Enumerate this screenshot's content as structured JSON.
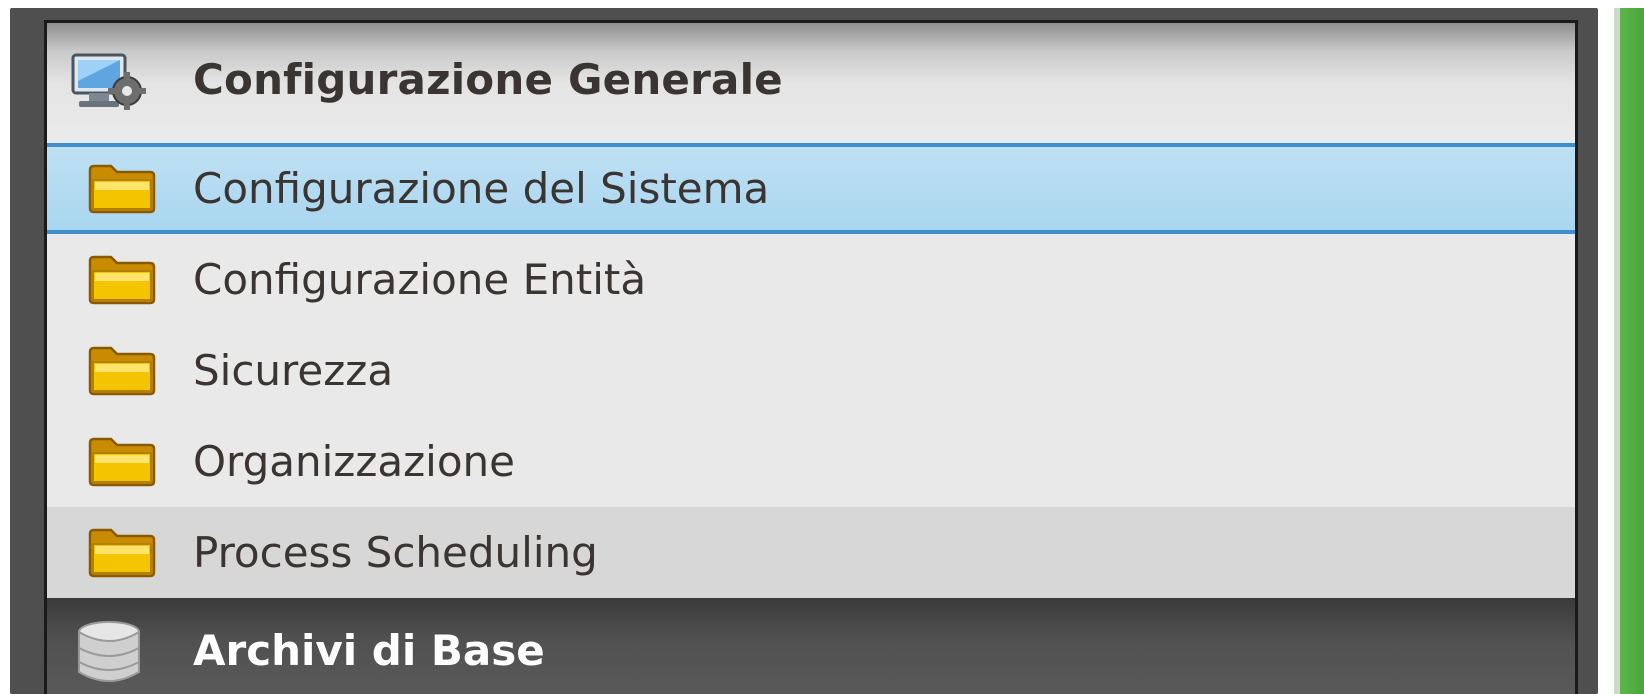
{
  "sections": [
    {
      "title": "Configurazione Generale",
      "icon": "computer-settings-icon",
      "expanded": true,
      "items": [
        {
          "label": "Configurazione del Sistema",
          "icon": "folder-icon",
          "state": "selected"
        },
        {
          "label": "Configurazione Entità",
          "icon": "folder-icon",
          "state": "normal"
        },
        {
          "label": "Sicurezza",
          "icon": "folder-icon",
          "state": "normal"
        },
        {
          "label": "Organizzazione",
          "icon": "folder-icon",
          "state": "normal"
        },
        {
          "label": "Process Scheduling",
          "icon": "folder-icon",
          "state": "hovered"
        }
      ]
    },
    {
      "title": "Archivi di Base",
      "icon": "database-icon",
      "expanded": false
    }
  ],
  "colors": {
    "selection_fill": "#a9d6ef",
    "selection_border": "#3e8fcb",
    "folder_yellow": "#f5c400",
    "accent_green": "#4aa63a"
  }
}
